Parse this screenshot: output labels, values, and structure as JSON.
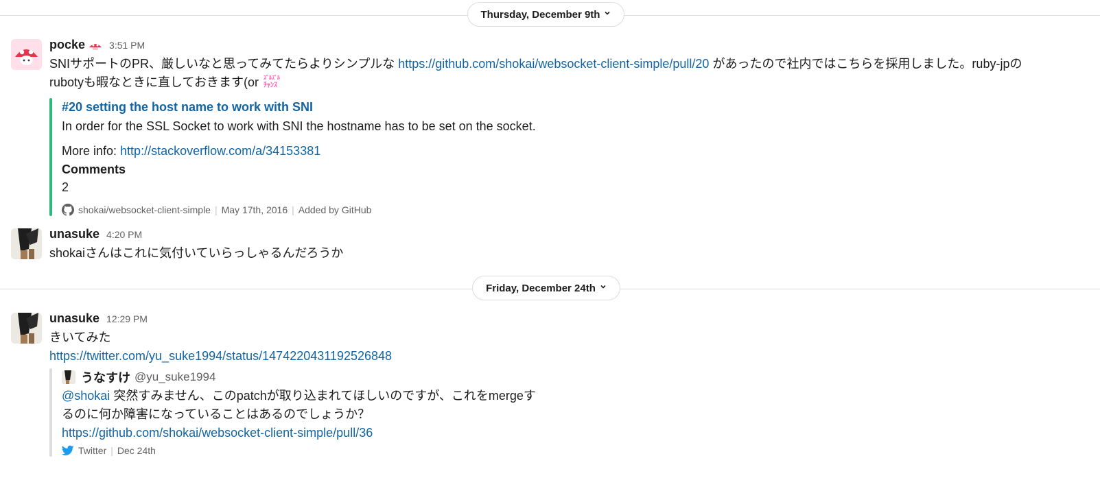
{
  "dividers": [
    {
      "label": "Thursday, December 9th"
    },
    {
      "label": "Friday, December 24th"
    }
  ],
  "messages": [
    {
      "author": "pocke",
      "time": "3:51 PM",
      "text_1": "SNIサポートのPR、厳しいなと思ってみてたらよりシンプルな ",
      "link": "https://github.com/shokai/websocket-client-simple/pull/20",
      "text_2": " があったので社内ではこちらを採用しました。ruby-jpの",
      "text_3": "rubotyも暇なときに直しておきます(or",
      "emoji_name": "zuruzuru-chance-emoji",
      "attachment": {
        "color": "#2eb67d",
        "title": "#20 setting the host name to work with SNI",
        "text": "In order for the SSL Socket to work with SNI the hostname has to be set on the socket.",
        "more_info_label": "More info: ",
        "more_info_link": "http://stackoverflow.com/a/34153381",
        "field_title": "Comments",
        "field_value": "2",
        "footer_icon": "github-icon",
        "footer_repo": "shokai/websocket-client-simple",
        "footer_date": "May 17th, 2016",
        "footer_added": "Added by GitHub"
      }
    },
    {
      "author": "unasuke",
      "time": "4:20 PM",
      "text": "shokaiさんはこれに気付いていらっしゃるんだろうか"
    },
    {
      "author": "unasuke",
      "time": "12:29 PM",
      "text": "きいてみた",
      "link": "https://twitter.com/yu_suke1994/status/1474220431192526848",
      "tweet": {
        "color": "#dddddd",
        "display_name": "うなすけ",
        "handle": "@yu_suke1994",
        "mention": "@shokai",
        "text_1": " 突然すみません、このpatchが取り込まれてほしいのですが、これをmergeす",
        "text_2": "るのに何か障害になっていることはあるのでしょうか？",
        "link": "https://github.com/shokai/websocket-client-simple/pull/36",
        "footer_icon": "twitter-icon",
        "footer_service": "Twitter",
        "footer_date": "Dec 24th"
      }
    }
  ]
}
